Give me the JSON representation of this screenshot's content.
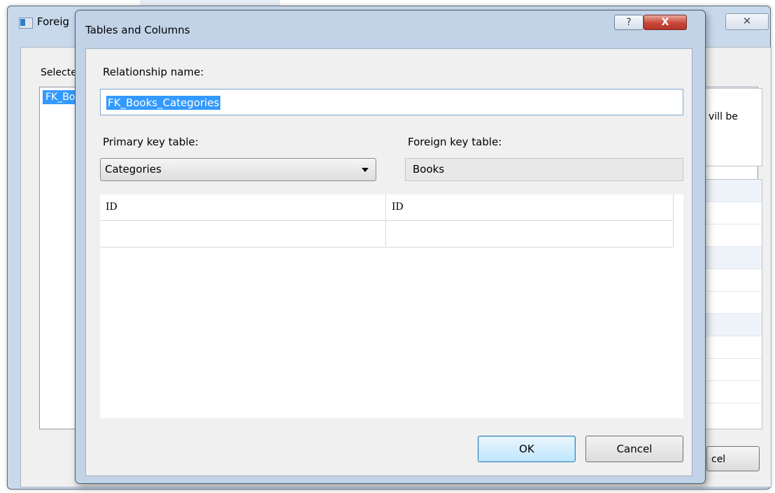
{
  "background_window": {
    "title": "Foreig",
    "close_glyph": "✕",
    "selected_label": "Selecte",
    "list_item": "FK_Bo",
    "info_text": "vill be",
    "cancel_fragment": "cel"
  },
  "dialog": {
    "title": "Tables and Columns",
    "help_glyph": "?",
    "close_glyph": "X",
    "relationship_label": "Relationship name:",
    "relationship_value": "FK_Books_Categories",
    "primary_key_label": "Primary key table:",
    "primary_key_value": "Categories",
    "foreign_key_label": "Foreign key table:",
    "foreign_key_value": "Books",
    "columns": [
      {
        "primary": "ID",
        "foreign": "ID"
      },
      {
        "primary": "",
        "foreign": ""
      }
    ],
    "ok_label": "OK",
    "cancel_label": "Cancel"
  },
  "colors": {
    "dialog_frame": "#c2d3e8",
    "selection": "#3399ff",
    "close_button": "#c9473a"
  }
}
